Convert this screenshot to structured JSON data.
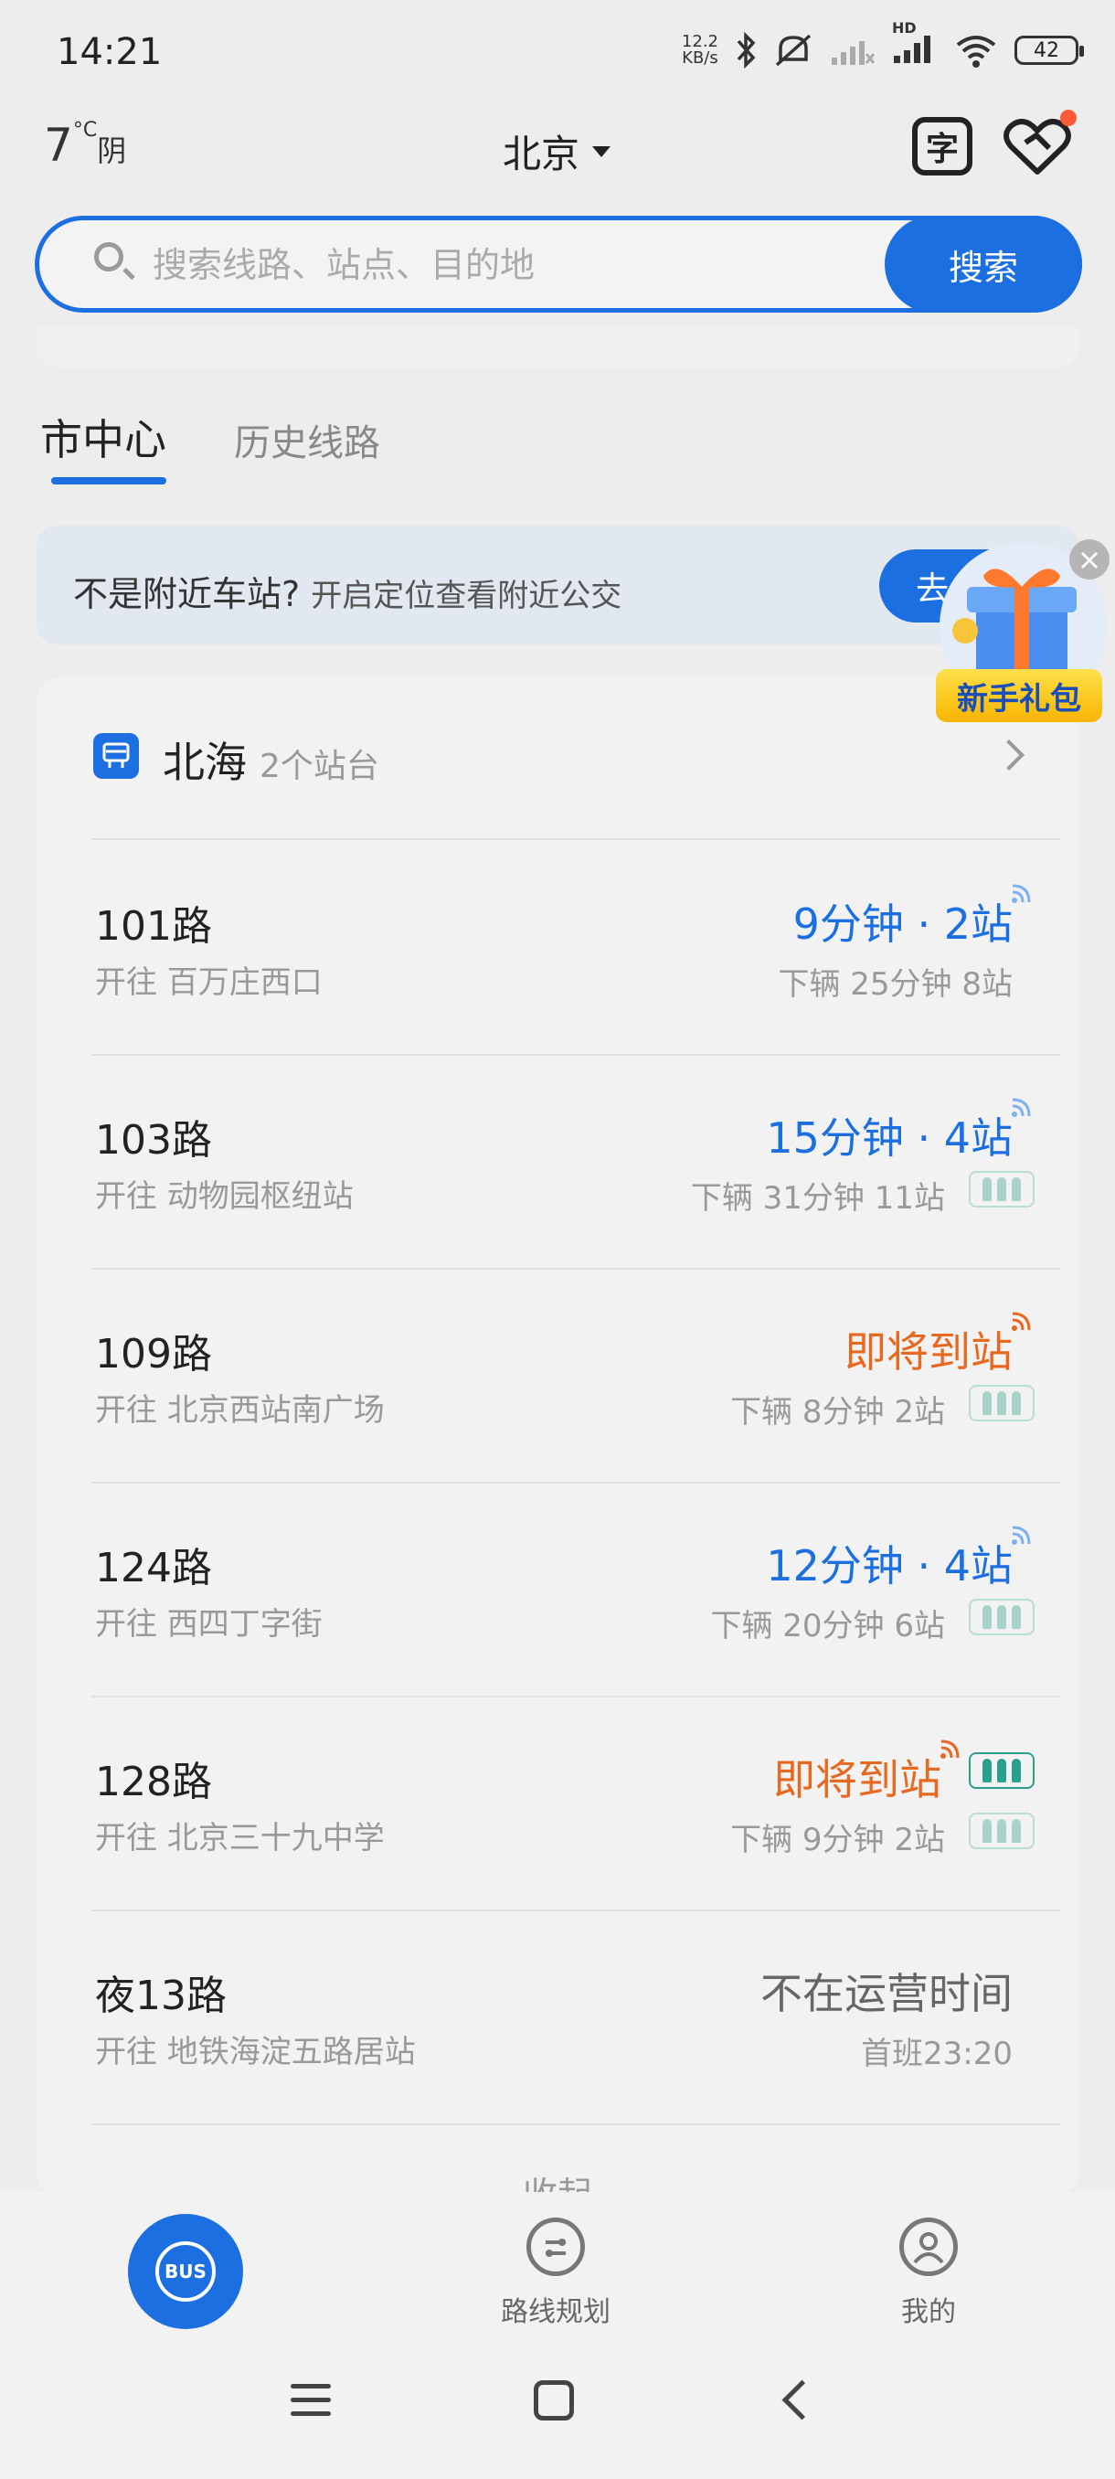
{
  "status_bar": {
    "time": "14:21",
    "net_speed": "12.2",
    "net_unit": "KB/s",
    "hd_label": "HD",
    "battery": "42",
    "icons": [
      "bluetooth-icon",
      "mute-icon",
      "signal-weak-icon",
      "signal-icon",
      "wifi-icon",
      "battery-icon"
    ]
  },
  "header": {
    "temperature": "7",
    "temp_unit": "°C",
    "weather": "阴",
    "city": "北京",
    "ocr_label": "字"
  },
  "search": {
    "placeholder": "搜索线路、站点、目的地",
    "button": "搜索"
  },
  "tabs": {
    "active": "市中心",
    "inactive": "历史线路"
  },
  "banner": {
    "title": "不是附近车站?",
    "subtitle": "开启定位查看附近公交",
    "button": "去"
  },
  "gift": {
    "label": "新手礼包"
  },
  "station": {
    "name": "北海",
    "count": "2个站台"
  },
  "routes": [
    {
      "route": "101路",
      "dest": "开往 百万庄西口",
      "eta": "9分钟 · 2站",
      "eta_color": "blue",
      "sub": "下辆  25分钟 8站",
      "crowd": []
    },
    {
      "route": "103路",
      "dest": "开往 动物园枢纽站",
      "eta": "15分钟 · 4站",
      "eta_color": "blue",
      "sub": "下辆  31分钟 11站",
      "crowd": [
        "sub"
      ]
    },
    {
      "route": "109路",
      "dest": "开往 北京西站南广场",
      "eta": "即将到站",
      "eta_color": "orange",
      "sub": "下辆  8分钟 2站",
      "crowd": [
        "sub"
      ]
    },
    {
      "route": "124路",
      "dest": "开往 西四丁字街",
      "eta": "12分钟 · 4站",
      "eta_color": "blue",
      "sub": "下辆  20分钟 6站",
      "crowd": [
        "sub"
      ]
    },
    {
      "route": "128路",
      "dest": "开往 北京三十九中学",
      "eta": "即将到站",
      "eta_color": "orange",
      "sub": "下辆  9分钟 2站",
      "crowd": [
        "eta",
        "sub"
      ]
    },
    {
      "route": "夜13路",
      "dest": "开往 地铁海淀五路居站",
      "eta": "不在运营时间",
      "eta_color": "gray",
      "sub": "首班23:20",
      "crowd": []
    }
  ],
  "collapse": "收起",
  "bottom_nav": {
    "bus": "BUS",
    "route_plan": "路线规划",
    "mine": "我的"
  },
  "colors": {
    "accent": "#1b6fe0",
    "arriving": "#e8681f",
    "background": "#ededed"
  }
}
